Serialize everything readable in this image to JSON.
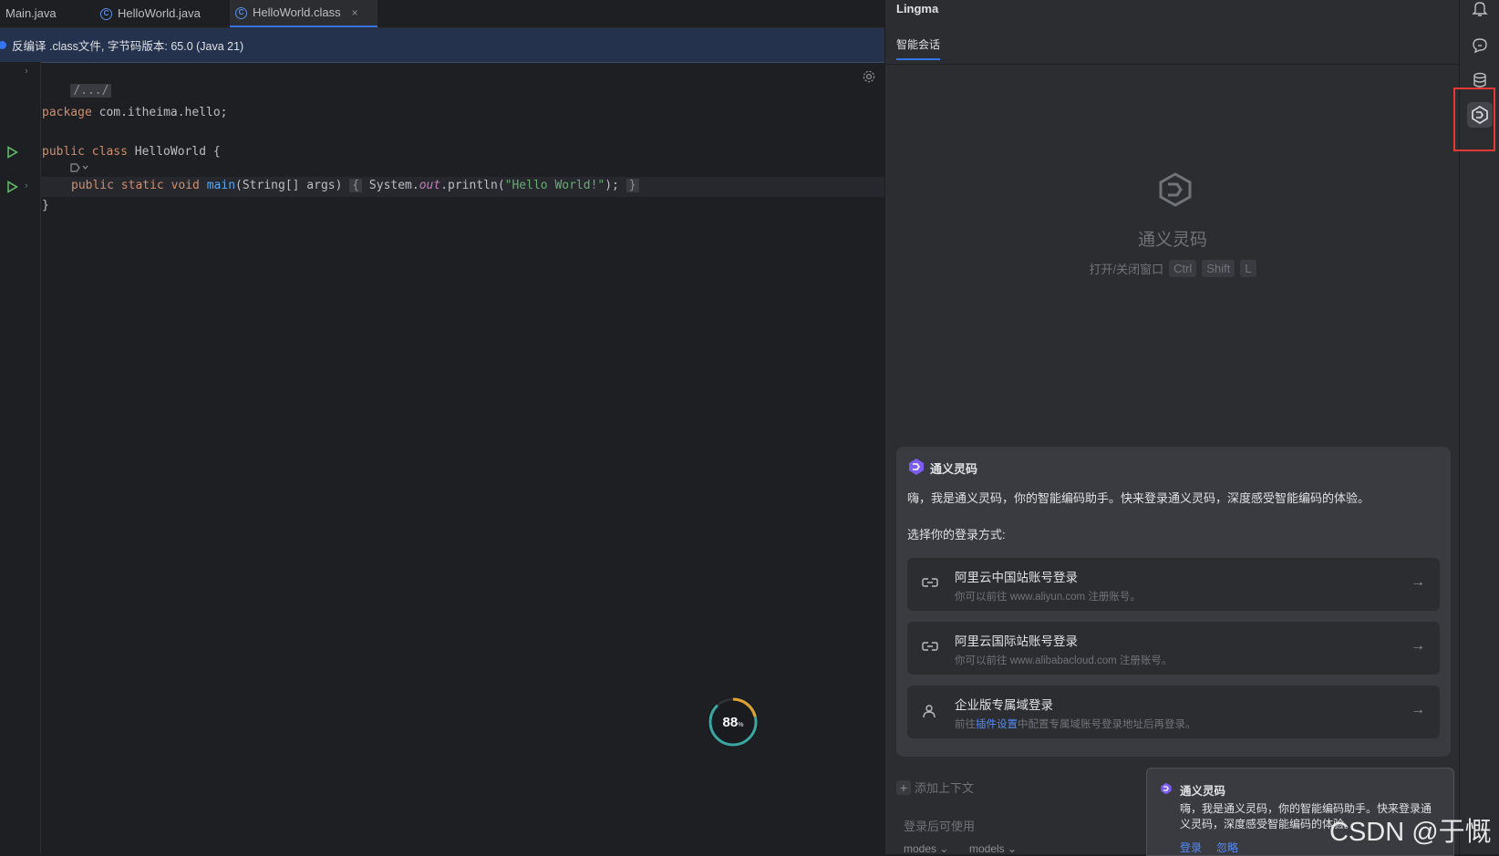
{
  "editor": {
    "tabs": [
      {
        "label": "Main.java",
        "active": false
      },
      {
        "label": "HelloWorld.java",
        "active": false
      },
      {
        "label": "HelloWorld.class",
        "active": true,
        "close": "×"
      }
    ],
    "banner": "反编译 .class文件, 字节码版本: 65.0 (Java 21)",
    "code": {
      "fold_header": "/.../",
      "l_package_kw": "package",
      "l_package_rest": " com.itheima.hello;",
      "l_class_kw": "public class",
      "l_class_rest": " HelloWorld {",
      "l_main_kw": "public static void",
      "l_main_fn": "main",
      "l_main_args": "(String[] args) ",
      "l_main_open": "{",
      "l_main_sys": " System.",
      "l_main_out": "out",
      "l_main_println": ".println(",
      "l_main_str": "\"Hello World!\"",
      "l_main_end": ");",
      "l_main_close": "}",
      "l_close": "}"
    },
    "perf_widget": {
      "value": "88",
      "unit": "%"
    }
  },
  "panel": {
    "title": "Lingma",
    "tab": "智能会话",
    "empty": {
      "name": "通义灵码",
      "shortcut_label": "打开/关闭窗口",
      "keys": [
        "Ctrl",
        "Shift",
        "L"
      ]
    },
    "login_card": {
      "title": "通义灵码",
      "greeting": "嗨，我是通义灵码，你的智能编码助手。快来登录通义灵码，深度感受智能编码的体验。",
      "select_label": "选择你的登录方式:",
      "options": [
        {
          "title": "阿里云中国站账号登录",
          "sub": "你可以前往 www.aliyun.com 注册账号。"
        },
        {
          "title": "阿里云国际站账号登录",
          "sub": "你可以前往 www.alibabacloud.com 注册账号。"
        },
        {
          "title": "企业版专属域登录",
          "sub_pre": "前往",
          "sub_link": "插件设置",
          "sub_post": "中配置专属域账号登录地址后再登录。"
        }
      ]
    },
    "input": {
      "add_context": "添加上下文",
      "disabled_hint": "登录后可使用",
      "modes": "modes",
      "models": "models"
    },
    "toast": {
      "title": "通义灵码",
      "body": "嗨，我是通义灵码，你的智能编码助手。快来登录通义灵码，深度感受智能编码的体验。",
      "login": "登录",
      "ignore": "忽略"
    }
  },
  "toolbar_icons": [
    "bell-icon",
    "chat-icon",
    "database-icon",
    "lingma-icon"
  ],
  "watermark": "CSDN @于慨",
  "colors": {
    "accent": "#3574f0",
    "highlight_box": "#e53935",
    "link": "#548af7"
  }
}
